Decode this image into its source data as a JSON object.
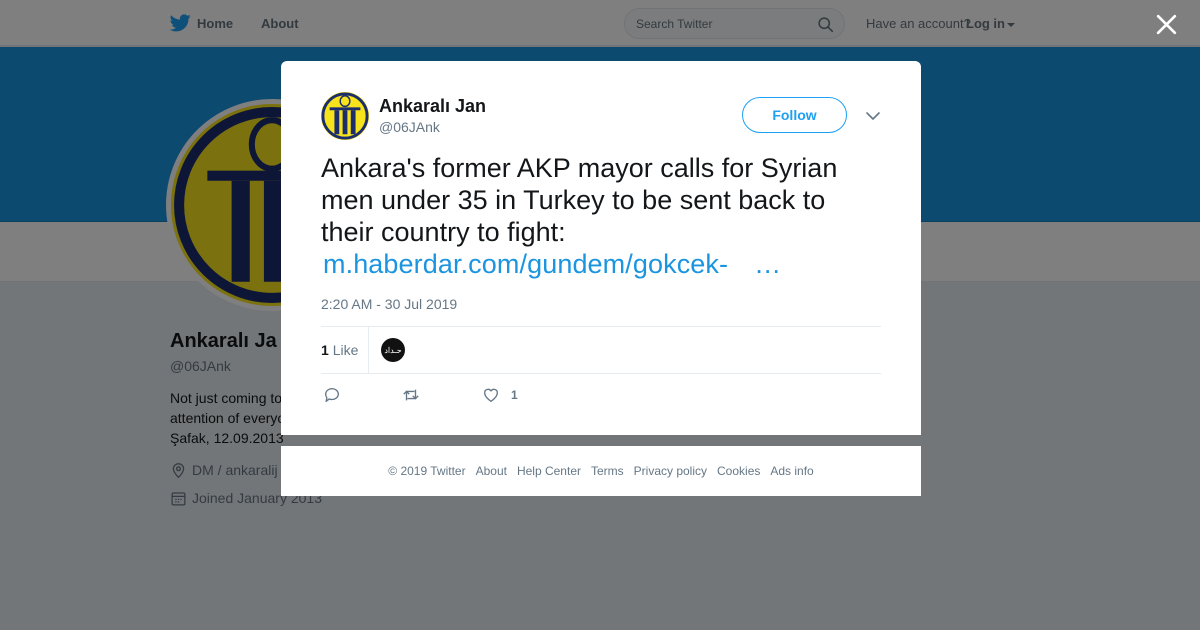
{
  "topbar": {
    "home_label": "Home",
    "about_label": "About",
    "search_placeholder": "Search Twitter",
    "account_prompt": "Have an account?",
    "login_label": "Log in"
  },
  "profile": {
    "name": "Ankaralı Ja",
    "handle": "@06JAnk",
    "bio_lines": [
      "Not just coming to",
      "attention of everyo",
      "Şafak, 12.09.2013"
    ],
    "location": "DM / ankaralij",
    "joined": "Joined January 2013"
  },
  "tweet": {
    "author_name": "Ankaralı Jan",
    "author_handle": "@06JAnk",
    "follow_label": "Follow",
    "text": "Ankara's former AKP mayor calls for Syrian men under 35 in Turkey to be sent back to their country to fight:",
    "link_text": "m.haberdar.com/gundem/gokcek-",
    "link_ellipsis": "…",
    "timestamp": "2:20 AM - 30 Jul 2019",
    "like_count": "1",
    "like_label": "Like",
    "liker_avatar_text": "حـداد",
    "action_like_count": "1"
  },
  "footer": {
    "links": [
      "© 2019 Twitter",
      "About",
      "Help Center",
      "Terms",
      "Privacy policy",
      "Cookies",
      "Ads info"
    ]
  },
  "colors": {
    "twitter_blue": "#1da1f2",
    "banner": "#1b95e0",
    "club_yellow": "#f7e31c",
    "club_navy": "#1c2d6e"
  },
  "icons": [
    "twitter-bird-icon",
    "search-icon",
    "caret-down-icon",
    "close-icon",
    "chevron-down-icon",
    "reply-icon",
    "retweet-icon",
    "heart-icon",
    "location-icon",
    "calendar-icon"
  ]
}
